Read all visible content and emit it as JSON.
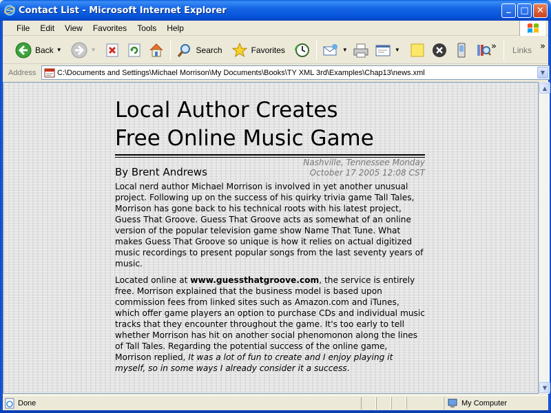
{
  "window": {
    "title": "Contact List - Microsoft Internet Explorer",
    "minimize_glyph": "_",
    "maximize_glyph": "□",
    "close_glyph": "✕"
  },
  "menu": {
    "items": [
      "File",
      "Edit",
      "View",
      "Favorites",
      "Tools",
      "Help"
    ]
  },
  "toolbar": {
    "back_label": "Back",
    "search_label": "Search",
    "favorites_label": "Favorites",
    "links_label": "Links",
    "more_glyph": "»"
  },
  "address": {
    "label": "Address",
    "url": "C:\\Documents and Settings\\Michael Morrison\\My Documents\\Books\\TY XML 3rd\\Examples\\Chap13\\news.xml"
  },
  "article": {
    "headline_line1": "Local Author Creates",
    "headline_line2": "Free Online Music Game",
    "location": "Nashville, Tennessee Monday",
    "date": "October 17 2005 12:08 CST",
    "byline": "By Brent Andrews",
    "para1": "Local nerd author Michael Morrison is involved in yet another unusual project. Following up on the success of his quirky trivia game Tall Tales, Morrison has gone back to his technical roots with his latest project, Guess That Groove. Guess That Groove acts as somewhat of an online version of the popular television game show Name That Tune. What makes Guess That Groove so unique is how it relies on actual digitized music recordings to present popular songs from the last seventy years of music.",
    "para2_start": "Located online at ",
    "para2_link": "www.guessthatgroove.com",
    "para2_middle": ", the service is entirely free. Morrison explained that the business model is based upon commission fees from linked sites such as Amazon.com and iTunes, which offer game players an option to purchase CDs and individual music tracks that they encounter throughout the game. It's too early to tell whether Morrison has hit on another social phenomonon along the lines of Tall Tales. Regarding the potential success of the online game, Morrison replied, ",
    "para2_quote": "It was a lot of fun to create and I enjoy playing it myself, so in some ways I already consider it a success",
    "para2_end": "."
  },
  "status": {
    "text": "Done",
    "zone": "My Computer"
  },
  "colors": {
    "titlebar": "#0551d6",
    "window_bg": "#ece9d8",
    "dateline": "#777777"
  }
}
